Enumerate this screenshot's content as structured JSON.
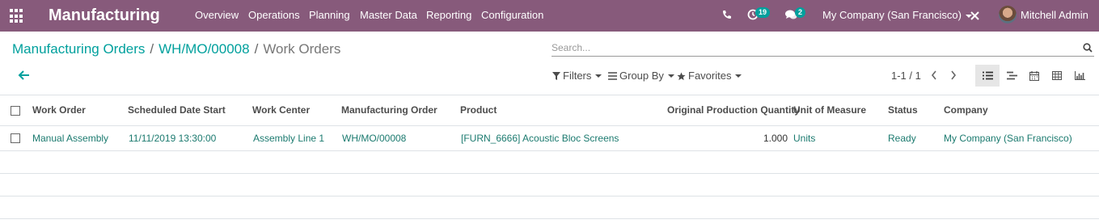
{
  "app": {
    "title": "Manufacturing"
  },
  "nav": {
    "menu": [
      "Overview",
      "Operations",
      "Planning",
      "Master Data",
      "Reporting",
      "Configuration"
    ],
    "activity_count": "19",
    "message_count": "2",
    "company": "My Company (San Francisco)",
    "user": "Mitchell Admin",
    "icons": [
      "apps-grid-icon",
      "phone-icon",
      "clock-icon",
      "chat-icon",
      "debug-tools-icon"
    ]
  },
  "breadcrumb": {
    "items": [
      "Manufacturing Orders",
      "WH/MO/00008"
    ],
    "separator": "/",
    "current": "Work Orders"
  },
  "search": {
    "placeholder": "Search...",
    "value": ""
  },
  "filters": {
    "filters_label": "Filters",
    "groupby_label": "Group By",
    "favorites_label": "Favorites"
  },
  "pager": {
    "text": "1-1 / 1"
  },
  "views": [
    "list-view-icon",
    "gantt-view-icon",
    "calendar-view-icon",
    "pivot-view-icon",
    "graph-view-icon"
  ],
  "table": {
    "columns": [
      "Work Order",
      "Scheduled Date Start",
      "Work Center",
      "Manufacturing Order",
      "Product",
      "Original Production Quantity",
      "Unit of Measure",
      "Status",
      "Company"
    ],
    "rows": [
      [
        "Manual Assembly",
        "11/11/2019 13:30:00",
        "Assembly Line 1",
        "WH/MO/00008",
        "[FURN_6666] Acoustic Bloc Screens",
        "1.000",
        "Units",
        "Ready",
        "My Company (San Francisco)"
      ]
    ]
  },
  "colors": {
    "navbar": "#875a7b",
    "accent": "#00a09d",
    "link": "#1b7a6f"
  }
}
